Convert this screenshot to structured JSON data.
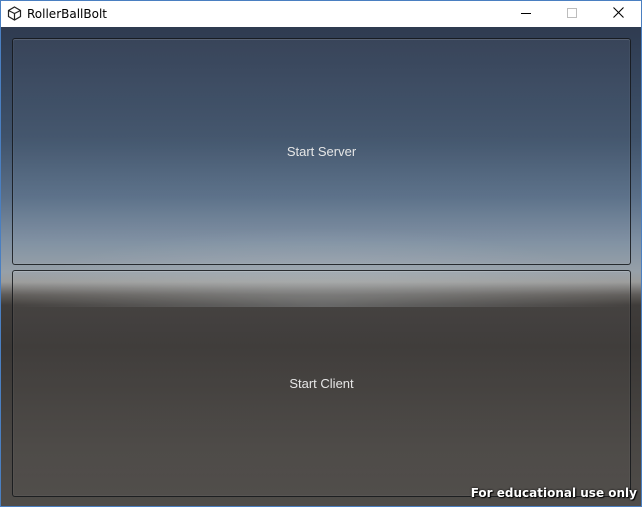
{
  "window": {
    "title": "RollerBallBolt",
    "icon": "unity-logo-icon",
    "controls": {
      "minimize": "minimize-icon",
      "maximize": "maximize-icon",
      "close": "close-icon"
    }
  },
  "game": {
    "buttons": {
      "server_label": "Start Server",
      "client_label": "Start Client"
    },
    "watermark": "For educational use only"
  },
  "colors": {
    "sky_top": "#2f3b50",
    "horizon": "#9a9b9a",
    "ground": "#3f3c3a",
    "button_text": "#e6e6e6",
    "window_border": "#4a7fc1"
  }
}
